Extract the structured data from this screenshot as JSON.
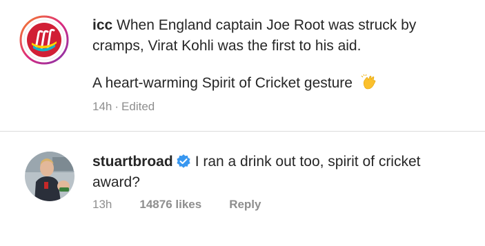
{
  "comments": [
    {
      "username": "icc",
      "text_line1": "When England captain Joe Root was struck by",
      "text_line2": "cramps, Virat Kohli was the first to his aid.",
      "paragraph2": "A heart-warming Spirit of Cricket gesture",
      "time": "14h",
      "separator": "·",
      "edited": "Edited",
      "emoji_icon": "clapping-hands-icon"
    },
    {
      "username": "stuartbroad",
      "verified_icon": "verified-badge-icon",
      "text_line1": "I ran a drink out too, spirit of cricket",
      "text_line2": "award?",
      "time": "13h",
      "likes": "14876 likes",
      "reply": "Reply"
    }
  ],
  "colors": {
    "text": "#262626",
    "meta": "#8e8e8e",
    "verified_blue": "#3897f0",
    "divider": "#dbdbdb"
  }
}
